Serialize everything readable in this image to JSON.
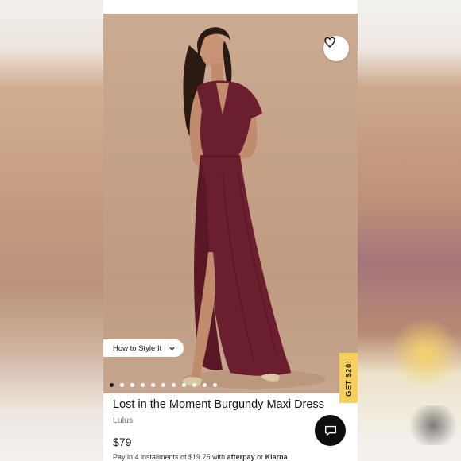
{
  "product": {
    "title": "Lost in the Moment Burgundy Maxi Dress",
    "brand": "Lulus",
    "price": "$79",
    "installments_prefix": "Pay in 4 installments of $19.75 with",
    "installments_provider_1": "afterpay",
    "installments_or": "or",
    "installments_provider_2": "Klarna",
    "image_alt": "burgundy-maxi-dress-photo"
  },
  "gallery": {
    "total_images": 11,
    "active_index": 0,
    "style_button_label": "How to Style It"
  },
  "promo": {
    "label": "GET $20!"
  },
  "icons": {
    "wishlist": "heart-icon",
    "chevron": "chevron-down-icon",
    "chat": "chat-bubble-icon"
  },
  "colors": {
    "dress": "#6b1e2e",
    "promo_tab": "#f7cf5b",
    "chat_button": "#0e0e0e",
    "photo_background": "#c4a187"
  }
}
